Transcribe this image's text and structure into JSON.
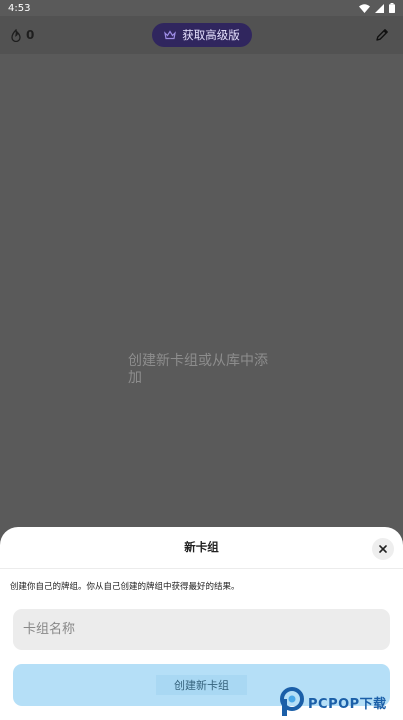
{
  "status_bar": {
    "time": "4:53",
    "icons": [
      "wifi-icon",
      "signal-icon",
      "battery-icon"
    ]
  },
  "top_bar": {
    "gem_count": "0",
    "premium_label": "获取高级版",
    "icons": [
      "gem-icon",
      "crown-icon",
      "pencil-icon"
    ]
  },
  "main": {
    "empty_message": "创建新卡组或从库中添加"
  },
  "sheet": {
    "title": "新卡组",
    "description": "创建你自己的牌组。你从自己创建的牌组中获得最好的结果。",
    "name_placeholder": "卡组名称",
    "name_value": "",
    "create_label": "创建新卡组",
    "icons": [
      "close-icon"
    ]
  },
  "watermark": {
    "text": "PCPOP下载"
  },
  "colors": {
    "overlay": "#5a5a5a",
    "premium_bg": "#30265e",
    "create_button_bg": "#b5dff7",
    "watermark_blue": "#1b5fa8"
  }
}
